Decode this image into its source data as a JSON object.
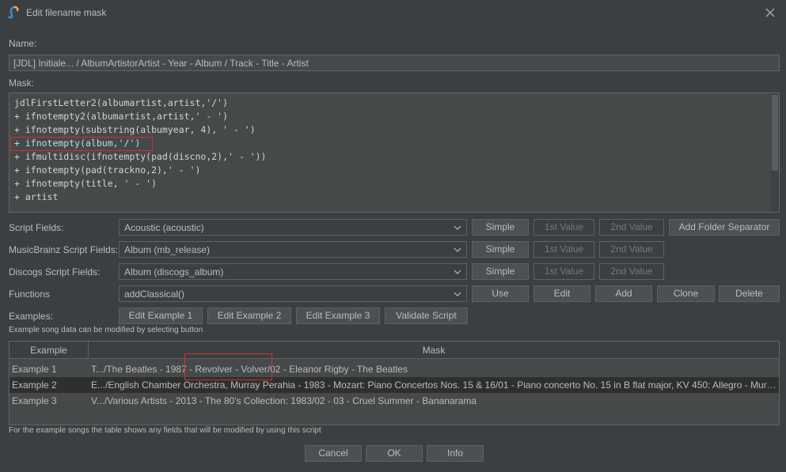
{
  "window": {
    "title": "Edit filename mask",
    "app_icon": "jaikoz-logo-icon",
    "close_icon": "close-icon"
  },
  "name": {
    "label": "Name:",
    "value": "[JDL] Initiale... / AlbumArtistorArtist - Year - Album / Track - Title - Artist"
  },
  "mask": {
    "label": "Mask:",
    "lines": [
      "jdlFirstLetter2(albumartist,artist,'/')",
      "+ ifnotempty2(albumartist,artist,' - ')",
      "+ ifnotempty(substring(albumyear, 4), ' - ')",
      "+ ifnotempty(album,'/')",
      "+ ifmultidisc(ifnotempty(pad(discno,2),' - '))",
      "+ ifnotempty(pad(trackno,2),' - ')",
      "+ ifnotempty(title, ' - ')",
      "+ artist"
    ]
  },
  "script_fields": {
    "label": "Script Fields:",
    "selected": "Acoustic (acoustic)",
    "buttons": {
      "simple": "Simple",
      "first": "1st Value",
      "second": "2nd Value",
      "folder_sep": "Add Folder Separator"
    }
  },
  "musicbrainz_fields": {
    "label": "MusicBrainz Script Fields:",
    "selected": "Album (mb_release)",
    "buttons": {
      "simple": "Simple",
      "first": "1st Value",
      "second": "2nd Value"
    }
  },
  "discogs_fields": {
    "label": "Discogs Script Fields:",
    "selected": "Album (discogs_album)",
    "buttons": {
      "simple": "Simple",
      "first": "1st Value",
      "second": "2nd Value"
    }
  },
  "functions": {
    "label": "Functions",
    "selected": "addClassical()",
    "buttons": {
      "use": "Use",
      "edit": "Edit",
      "add": "Add",
      "clone": "Clone",
      "delete": "Delete"
    }
  },
  "examples": {
    "label": "Examples:",
    "buttons": {
      "ex1": "Edit Example 1",
      "ex2": "Edit Example 2",
      "ex3": "Edit Example 3",
      "validate": "Validate Script"
    },
    "hint": "Example song data can be modified by selecting button"
  },
  "table": {
    "headers": {
      "example": "Example",
      "mask": "Mask"
    },
    "rows": [
      {
        "example": "Example 1",
        "mask": "T.../The Beatles - 1987 - Revolver - Volver/02 - Eleanor Rigby - The Beatles"
      },
      {
        "example": "Example 2",
        "mask": "E.../English Chamber Orchestra, Murray Perahia - 1983 - Mozart: Piano Concertos Nos. 15 & 16/01 - Piano concerto No. 15 in B flat major, KV 450: Allegro - Murray Perahia"
      },
      {
        "example": "Example 3",
        "mask": "V.../Various Artists - 2013 - The 80's Collection: 1983/02 - 03 - Cruel Summer - Bananarama"
      }
    ]
  },
  "footer_note": "For the example songs the table shows any fields that will be modified by using this script",
  "dialog_buttons": {
    "cancel": "Cancel",
    "ok": "OK",
    "info": "Info"
  }
}
